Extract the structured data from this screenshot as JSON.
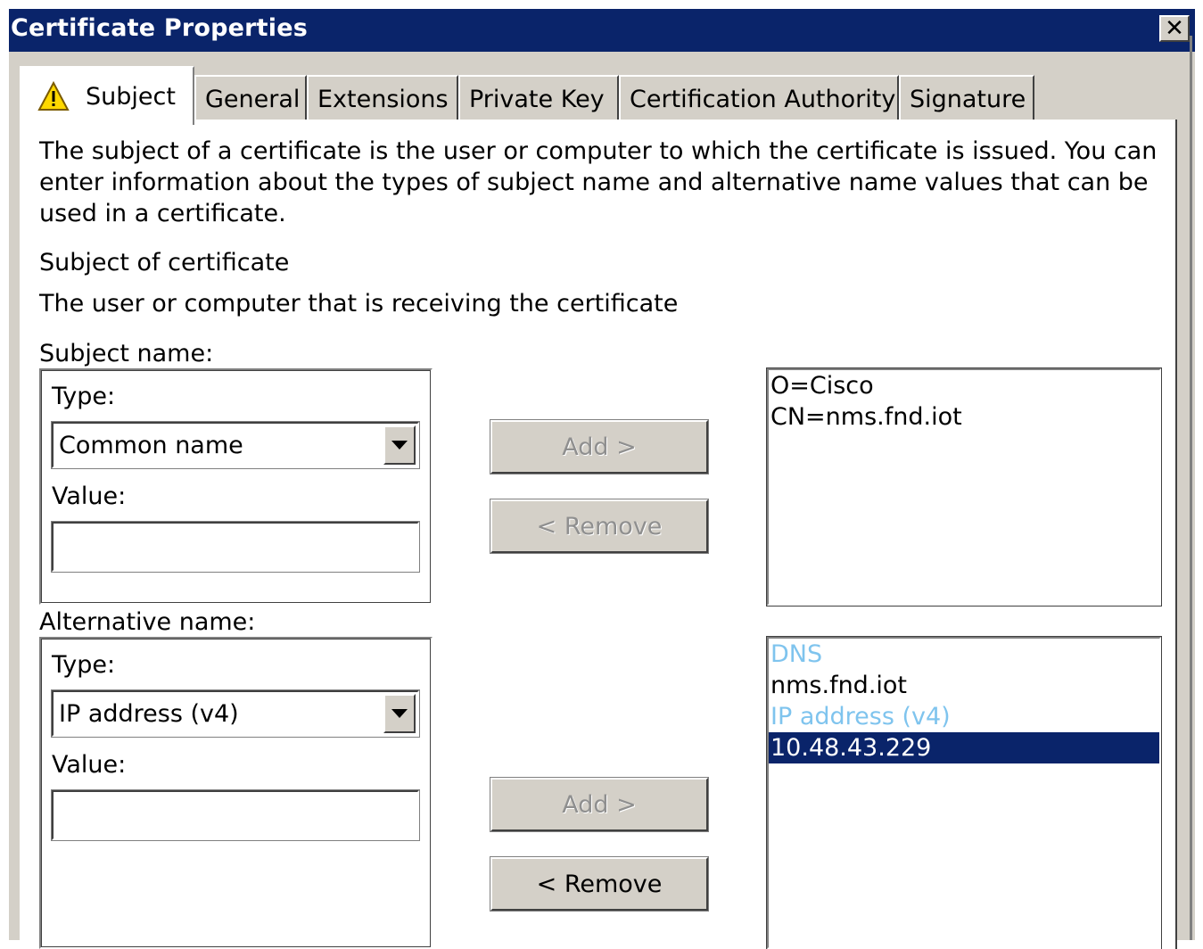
{
  "window": {
    "title": "Certificate Properties",
    "close_label": "✕"
  },
  "tabs": [
    {
      "label": "Subject",
      "active": true
    },
    {
      "label": "General"
    },
    {
      "label": "Extensions"
    },
    {
      "label": "Private Key"
    },
    {
      "label": "Certification Authority"
    },
    {
      "label": "Signature"
    }
  ],
  "intro": "The subject of a certificate is the user or computer to which the certificate is issued. You can enter information about the types of subject name and alternative name values that can be used in a certificate.",
  "subject_heading": "Subject of certificate",
  "subject_desc": "The user or computer that is receiving the certificate",
  "subject_name": {
    "label": "Subject name:",
    "type_label": "Type:",
    "type_value": "Common name",
    "value_label": "Value:",
    "value": "",
    "add_label": "Add >",
    "remove_label": "< Remove",
    "list": [
      "O=Cisco",
      "CN=nms.fnd.iot"
    ]
  },
  "alternative_name": {
    "label": "Alternative name:",
    "type_label": "Type:",
    "type_value": "IP address (v4)",
    "value_label": "Value:",
    "value": "",
    "add_label": "Add >",
    "remove_label": "< Remove",
    "list": [
      {
        "text": "DNS",
        "kind": "header"
      },
      {
        "text": "nms.fnd.iot",
        "kind": "item"
      },
      {
        "text": "IP address (v4)",
        "kind": "header"
      },
      {
        "text": "10.48.43.229",
        "kind": "selected"
      }
    ]
  },
  "colors": {
    "titlebar": "#0a246a",
    "header_text": "#7fc4ee",
    "face": "#d4d0c8"
  }
}
